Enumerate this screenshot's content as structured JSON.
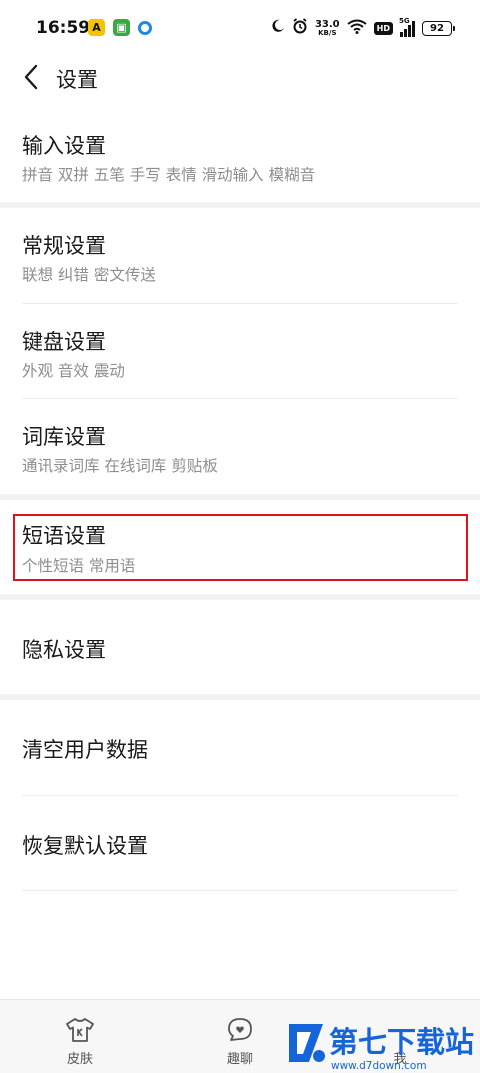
{
  "status_bar": {
    "time": "16:59",
    "notif_app_1": "A",
    "notif_app_2": "▣",
    "net_speed_value": "33.0",
    "net_speed_unit": "KB/S",
    "hd_label": "HD",
    "signal_label": "5G",
    "battery": "92"
  },
  "header": {
    "title": "设置"
  },
  "settings": {
    "input": {
      "title": "输入设置",
      "subtitle": "拼音 双拼 五笔 手写 表情 滑动输入 模糊音"
    },
    "general": {
      "title": "常规设置",
      "subtitle": "联想 纠错 密文传送"
    },
    "keyboard": {
      "title": "键盘设置",
      "subtitle": "外观 音效 震动"
    },
    "lexicon": {
      "title": "词库设置",
      "subtitle": "通讯录词库 在线词库 剪贴板"
    },
    "phrase": {
      "title": "短语设置",
      "subtitle": "个性短语 常用语"
    },
    "privacy": {
      "title": "隐私设置"
    },
    "clear_data": {
      "title": "清空用户数据"
    },
    "restore_default": {
      "title": "恢复默认设置"
    }
  },
  "bottom_nav": {
    "skin": "皮肤",
    "chat": "趣聊",
    "me": "我"
  },
  "watermark": {
    "title": "第七下载站",
    "url": "www.d7down.com"
  },
  "colors": {
    "highlight": "#e0101e",
    "watermark_blue": "#1565d8",
    "divider": "#f1f2f4"
  }
}
